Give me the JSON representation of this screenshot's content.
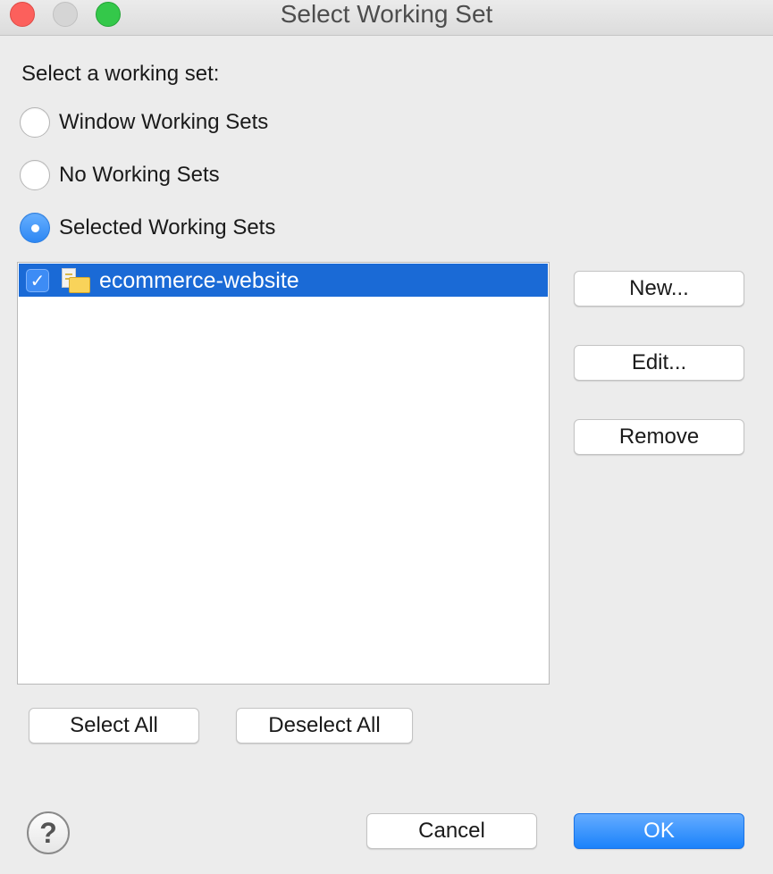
{
  "window": {
    "title": "Select Working Set"
  },
  "prompt": "Select a working set:",
  "radios": [
    {
      "label": "Window Working Sets",
      "checked": false
    },
    {
      "label": "No Working Sets",
      "checked": false
    },
    {
      "label": "Selected Working Sets",
      "checked": true
    }
  ],
  "working_sets": [
    {
      "label": "ecommerce-website",
      "checked": true,
      "selected": true,
      "icon": "working-set-icon",
      "check_glyph": "✓"
    }
  ],
  "side_buttons": {
    "new": "New...",
    "edit": "Edit...",
    "remove": "Remove"
  },
  "list_buttons": {
    "select_all": "Select All",
    "deselect_all": "Deselect All"
  },
  "footer": {
    "help_glyph": "?",
    "cancel": "Cancel",
    "ok": "OK"
  },
  "colors": {
    "accent": "#1a82fb",
    "selection": "#1a6ad6"
  }
}
